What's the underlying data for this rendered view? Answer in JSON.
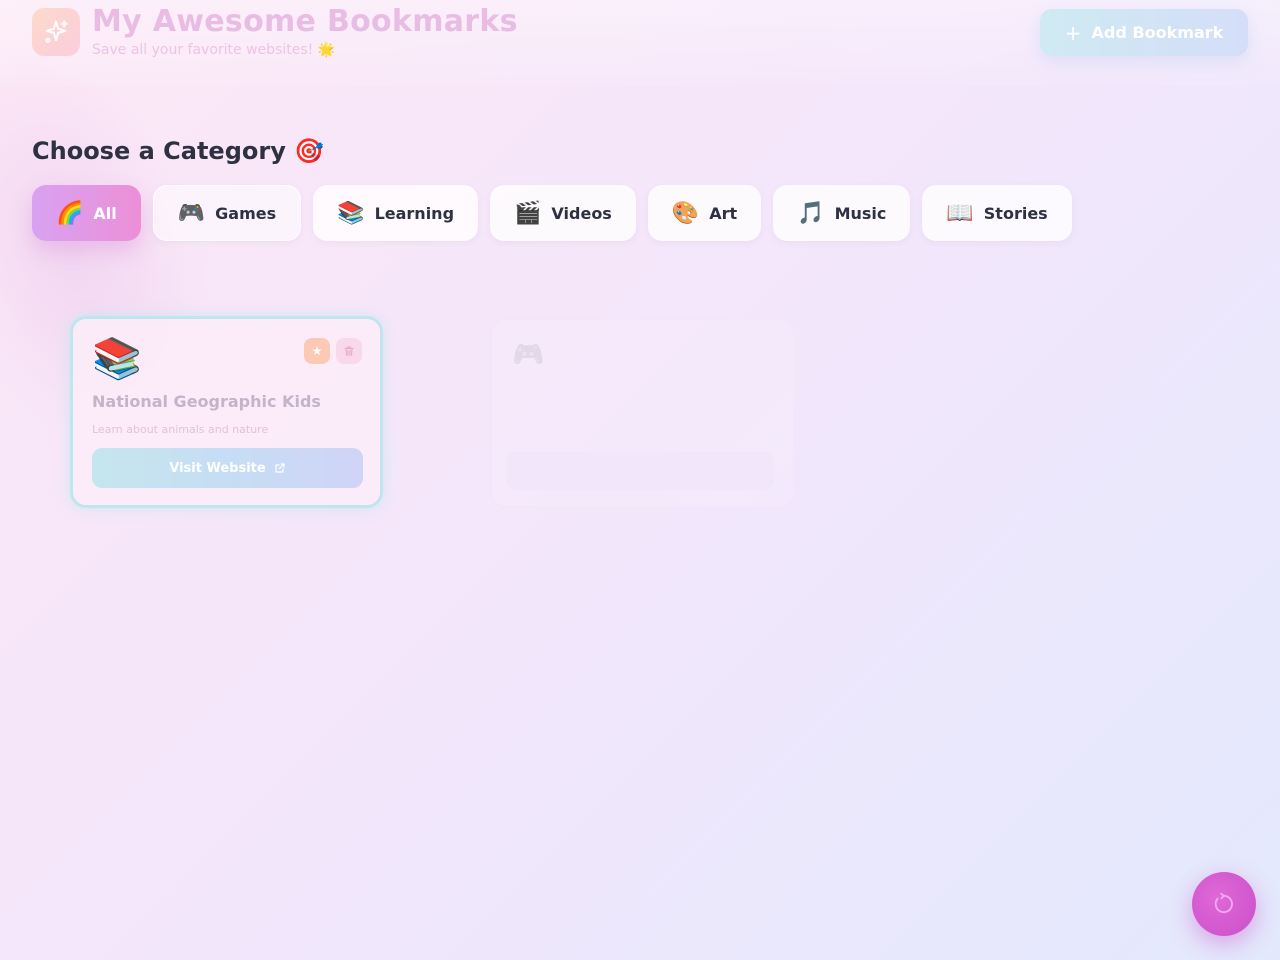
{
  "header": {
    "title": "My Awesome Bookmarks",
    "subtitle": "Save all your favorite websites! 🌟",
    "logo_icon": "sparkles-icon",
    "add_button_label": "Add Bookmark"
  },
  "categories": {
    "heading": "Choose a Category 🎯",
    "items": [
      {
        "emoji": "🌈",
        "label": "All",
        "active": true
      },
      {
        "emoji": "🎮",
        "label": "Games"
      },
      {
        "emoji": "📚",
        "label": "Learning"
      },
      {
        "emoji": "🎬",
        "label": "Videos"
      },
      {
        "emoji": "🎨",
        "label": "Art"
      },
      {
        "emoji": "🎵",
        "label": "Music"
      },
      {
        "emoji": "📖",
        "label": "Stories"
      }
    ]
  },
  "bookmarks": [
    {
      "emoji": "📚",
      "title": "National Geographic Kids",
      "description": "Learn about animals and nature",
      "visit_label": "Visit Website",
      "favorite": true
    },
    {
      "emoji": "🎮",
      "title": "",
      "description": "",
      "visit_label": ""
    }
  ],
  "colors": {
    "active_chip_start": "#d8a2f2",
    "active_chip_end": "#ec8fd6",
    "fab": "#d15cd0",
    "card_border": "#bfe6ef"
  }
}
